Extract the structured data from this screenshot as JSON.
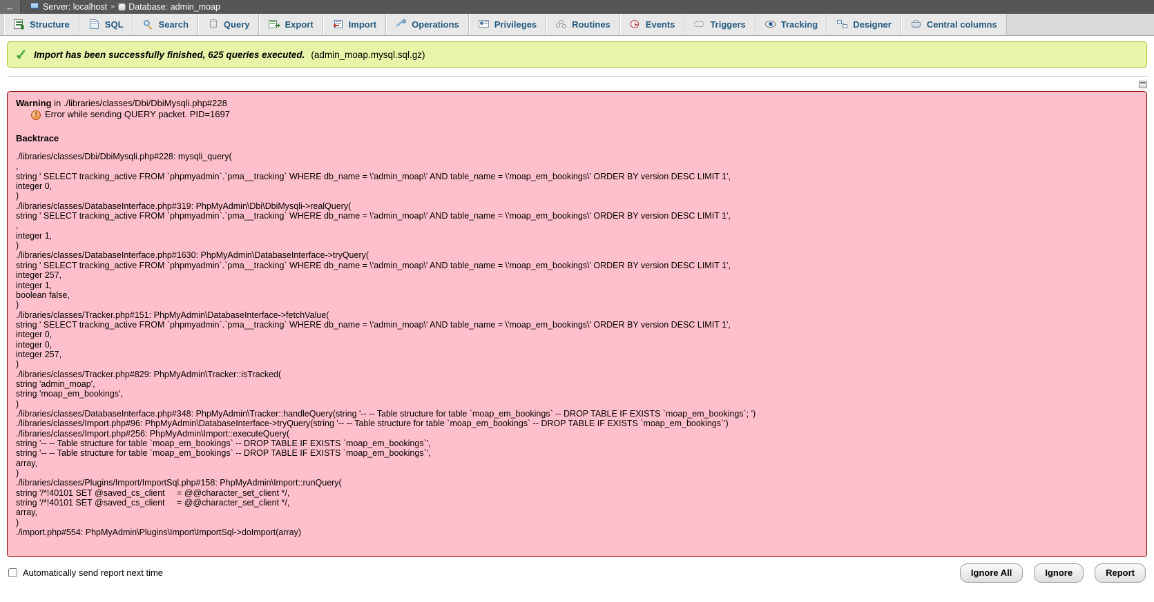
{
  "breadcrumb": {
    "back_label": "←",
    "server_icon": "server-icon",
    "server_label": "Server: localhost",
    "separator": "»",
    "database_icon": "database-icon",
    "database_label": "Database: admin_moap"
  },
  "tabs": [
    {
      "id": "structure",
      "label": "Structure",
      "icon": "structure-icon"
    },
    {
      "id": "sql",
      "label": "SQL",
      "icon": "sql-icon"
    },
    {
      "id": "search",
      "label": "Search",
      "icon": "search-icon"
    },
    {
      "id": "query",
      "label": "Query",
      "icon": "query-icon"
    },
    {
      "id": "export",
      "label": "Export",
      "icon": "export-icon"
    },
    {
      "id": "import",
      "label": "Import",
      "icon": "import-icon"
    },
    {
      "id": "operations",
      "label": "Operations",
      "icon": "wrench-icon"
    },
    {
      "id": "privileges",
      "label": "Privileges",
      "icon": "privileges-icon"
    },
    {
      "id": "routines",
      "label": "Routines",
      "icon": "gears-icon"
    },
    {
      "id": "events",
      "label": "Events",
      "icon": "clock-icon"
    },
    {
      "id": "triggers",
      "label": "Triggers",
      "icon": "triggers-icon"
    },
    {
      "id": "tracking",
      "label": "Tracking",
      "icon": "eye-icon"
    },
    {
      "id": "designer",
      "label": "Designer",
      "icon": "designer-icon"
    },
    {
      "id": "central-columns",
      "label": "Central columns",
      "icon": "basket-icon"
    }
  ],
  "success": {
    "icon": "check-icon",
    "message": "Import has been successfully finished, 625 queries executed.",
    "file": "(admin_moap.mysql.sql.gz)"
  },
  "corner_widget": {
    "name": "window-restore-icon"
  },
  "error": {
    "warning_word": "Warning",
    "warning_location": " in ./libraries/classes/Dbi/DbiMysqli.php#228",
    "error_icon": "exclamation-icon",
    "error_message": "Error while sending QUERY packet. PID=1697",
    "backtrace_title": "Backtrace",
    "backtrace": [
      "./libraries/classes/Dbi/DbiMysqli.php#228: mysqli_query(",
      ",",
      "string ' SELECT tracking_active FROM `phpmyadmin`.`pma__tracking` WHERE db_name = \\'admin_moap\\' AND table_name = \\'moap_em_bookings\\' ORDER BY version DESC LIMIT 1',",
      "integer 0,",
      ")",
      "./libraries/classes/DatabaseInterface.php#319: PhpMyAdmin\\Dbi\\DbiMysqli->realQuery(",
      "string ' SELECT tracking_active FROM `phpmyadmin`.`pma__tracking` WHERE db_name = \\'admin_moap\\' AND table_name = \\'moap_em_bookings\\' ORDER BY version DESC LIMIT 1',",
      ",",
      "integer 1,",
      ")",
      "./libraries/classes/DatabaseInterface.php#1630: PhpMyAdmin\\DatabaseInterface->tryQuery(",
      "string ' SELECT tracking_active FROM `phpmyadmin`.`pma__tracking` WHERE db_name = \\'admin_moap\\' AND table_name = \\'moap_em_bookings\\' ORDER BY version DESC LIMIT 1',",
      "integer 257,",
      "integer 1,",
      "boolean false,",
      ")",
      "./libraries/classes/Tracker.php#151: PhpMyAdmin\\DatabaseInterface->fetchValue(",
      "string ' SELECT tracking_active FROM `phpmyadmin`.`pma__tracking` WHERE db_name = \\'admin_moap\\' AND table_name = \\'moap_em_bookings\\' ORDER BY version DESC LIMIT 1',",
      "integer 0,",
      "integer 0,",
      "integer 257,",
      ")",
      "./libraries/classes/Tracker.php#829: PhpMyAdmin\\Tracker::isTracked(",
      "string 'admin_moap',",
      "string 'moap_em_bookings',",
      ")",
      "./libraries/classes/DatabaseInterface.php#348: PhpMyAdmin\\Tracker::handleQuery(string '-- -- Table structure for table `moap_em_bookings` -- DROP TABLE IF EXISTS `moap_em_bookings`; ')",
      "./libraries/classes/Import.php#96: PhpMyAdmin\\DatabaseInterface->tryQuery(string '-- -- Table structure for table `moap_em_bookings` -- DROP TABLE IF EXISTS `moap_em_bookings`')",
      "./libraries/classes/Import.php#256: PhpMyAdmin\\Import::executeQuery(",
      "string '-- -- Table structure for table `moap_em_bookings` -- DROP TABLE IF EXISTS `moap_em_bookings`',",
      "string '-- -- Table structure for table `moap_em_bookings` -- DROP TABLE IF EXISTS `moap_em_bookings`',",
      "array,",
      ")",
      "./libraries/classes/Plugins/Import/ImportSql.php#158: PhpMyAdmin\\Import::runQuery(",
      "string '/*!40101 SET @saved_cs_client     = @@character_set_client */,",
      "string '/*!40101 SET @saved_cs_client     = @@character_set_client */,",
      "array,",
      ")",
      "./import.php#554: PhpMyAdmin\\Plugins\\Import\\ImportSql->doImport(array)"
    ]
  },
  "footer": {
    "auto_report_label": "Automatically send report next time",
    "auto_report_checked": false,
    "buttons": [
      {
        "id": "ignore-all",
        "label": "Ignore All"
      },
      {
        "id": "ignore",
        "label": "Ignore"
      },
      {
        "id": "report",
        "label": "Report"
      }
    ]
  },
  "colors": {
    "breadcrumb_bg": "#565656",
    "tab_bar_bg": "#d9d9d9",
    "tab_text": "#235a81",
    "success_bg": "#e8f5a8",
    "success_border": "#a7c52c",
    "error_bg": "#ffc0cb",
    "error_border": "#8b0000"
  }
}
